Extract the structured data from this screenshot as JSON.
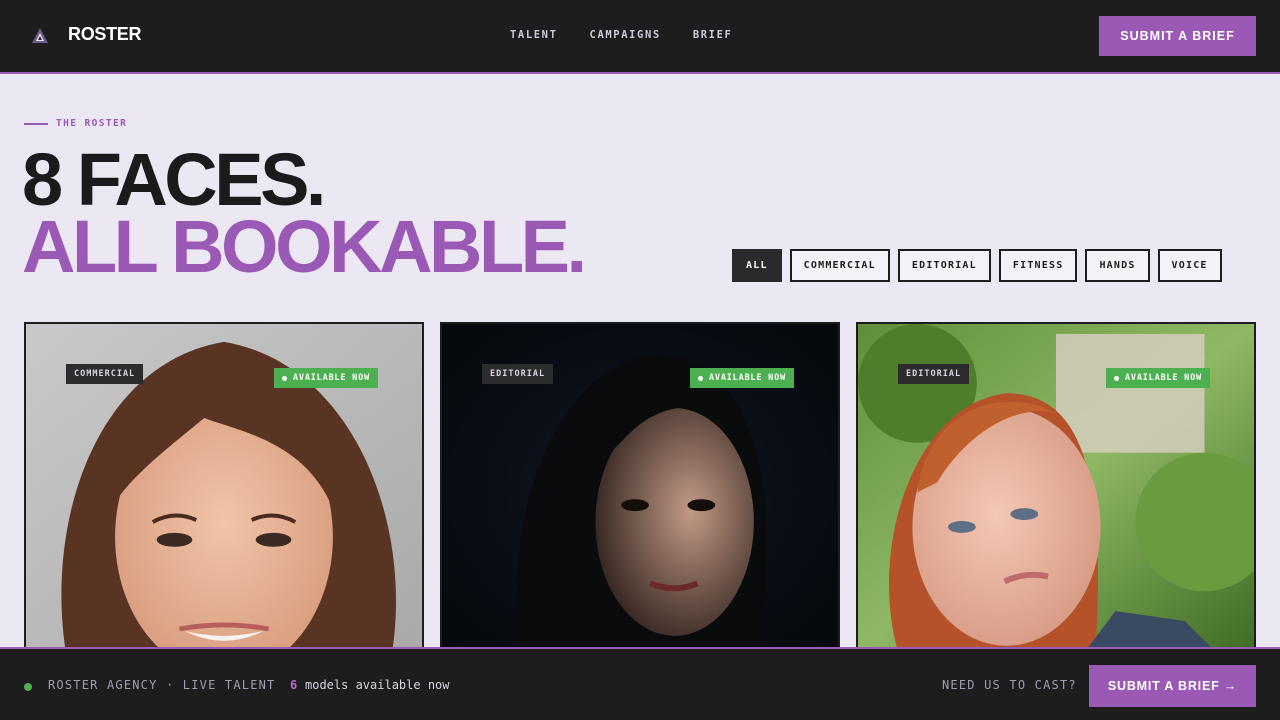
{
  "header": {
    "brand": "ROSTER",
    "logo_icon": "triangle-mark-icon",
    "nav": [
      "TALENT",
      "CAMPAIGNS",
      "BRIEF"
    ],
    "cta": "SUBMIT A BRIEF"
  },
  "hero": {
    "eyebrow": "THE ROSTER",
    "headline_line1": "8 FACES.",
    "headline_line2": "ALL BOOKABLE."
  },
  "filters": {
    "items": [
      "ALL",
      "COMMERCIAL",
      "EDITORIAL",
      "FITNESS",
      "HANDS",
      "VOICE"
    ],
    "active": "ALL"
  },
  "cards": [
    {
      "category": "COMMERCIAL",
      "status": "AVAILABLE NOW"
    },
    {
      "category": "EDITORIAL",
      "status": "AVAILABLE NOW"
    },
    {
      "category": "EDITORIAL",
      "status": "AVAILABLE NOW"
    }
  ],
  "footer_bar": {
    "live_label": "ROSTER AGENCY · LIVE TALENT",
    "count": "6",
    "count_label": "models available now",
    "prompt": "NEED US TO CAST?",
    "cta": "SUBMIT A BRIEF →"
  },
  "colors": {
    "accent": "#9b59b6",
    "dark": "#1d1d1e",
    "background": "#ece8f3",
    "available": "#4caf50"
  }
}
